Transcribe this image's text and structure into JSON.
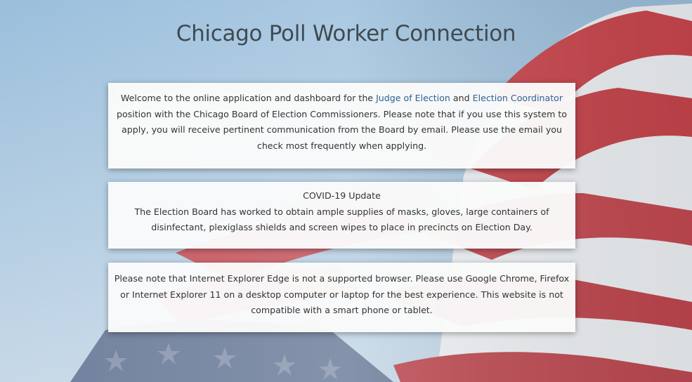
{
  "header": {
    "title": "Chicago Poll Worker Connection"
  },
  "welcome": {
    "intro": "Welcome to the online application and dashboard for the",
    "link_judge": "Judge of Election",
    "and_text": "and",
    "link_coordinator": "Election Coordinator",
    "body": "position with the Chicago Board of Election Commissioners. Please note that if you use this system to apply, you will receive pertinent communication from the Board by email. Please use the email you check most frequently when applying."
  },
  "covid": {
    "heading": "COVID-19 Update",
    "body": "The Election Board has worked to obtain ample supplies of masks, gloves, large containers of disinfectant, plexiglass shields and screen wipes to place in precincts on Election Day."
  },
  "browser_notice": {
    "body": "Please note that Internet Explorer Edge is not a supported browser. Please use Google Chrome, Firefox or Internet Explorer 11 on a desktop computer or laptop for the best experience. This website is not compatible with a smart phone or tablet."
  },
  "colors": {
    "link": "#2b6296",
    "text": "#333333",
    "title": "#3f4a52",
    "sky": "#b3cfe6",
    "flag_red": "#c6454c"
  }
}
